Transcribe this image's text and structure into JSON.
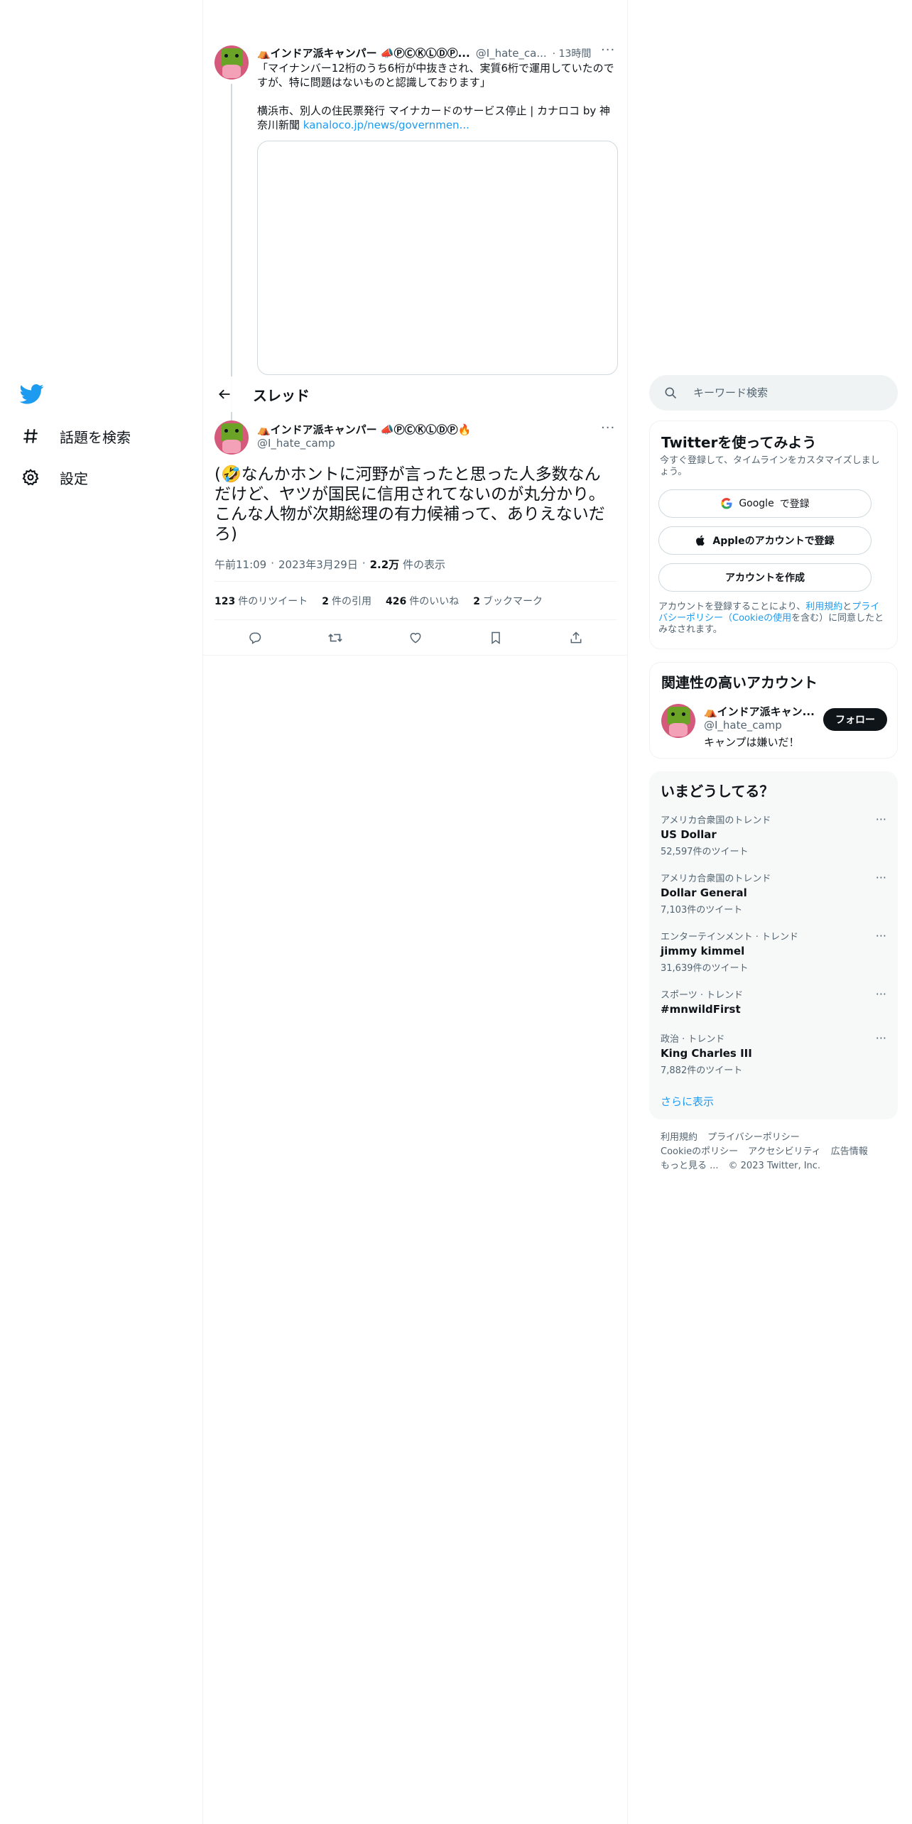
{
  "nav": {
    "items": [
      {
        "label": "話題を検索"
      },
      {
        "label": "設定"
      }
    ]
  },
  "previous_tweet": {
    "name": "⛺インドア派キャンパー 📣ⓅⒸⓀⓁⒹⓅ...",
    "handle": "@I_hate_ca...",
    "time": "· 13時間",
    "text_line1": "「マイナンバー12桁のうち6桁が中抜きされ、実質6桁で運用していたのですが、特に問題はないものと認識しております」",
    "text_line2": "横浜市、別人の住民票発行 マイナカードのサービス停止 | カナロコ by 神奈川新聞",
    "link": "kanaloco.jp/news/governmen..."
  },
  "header": {
    "title": "スレッド"
  },
  "main_tweet": {
    "name": "⛺インドア派キャンパー 📣ⓅⒸⓀⓁⒹⓅ🔥",
    "handle": "@I_hate_camp",
    "text": "(🤣なんかホントに河野が言ったと思った人多数なんだけど、ヤツが国民に信用されてないのが丸分かり。こんな人物が次期総理の有力候補って、ありえないだろ)",
    "time": "午前11:09",
    "date": "2023年3月29日",
    "views_num": "2.2万",
    "views_label": "件の表示",
    "stats": [
      {
        "num": "123",
        "label": "件のリツイート"
      },
      {
        "num": "2",
        "label": "件の引用"
      },
      {
        "num": "426",
        "label": "件のいいね"
      },
      {
        "num": "2",
        "label": "ブックマーク"
      }
    ]
  },
  "search": {
    "placeholder": "キーワード検索"
  },
  "signup": {
    "title": "Twitterを使ってみよう",
    "subtitle": "今すぐ登録して、タイムラインをカスタマイズしましょう。",
    "google_label": "で登録",
    "google_word": "Google",
    "apple_label": "Appleのアカウントで登録",
    "create_label": "アカウントを作成",
    "terms_prefix": "アカウントを登録することにより、",
    "terms_link1": "利用規約",
    "terms_and": "と",
    "terms_link2": "プライバシーポリシー（Cookieの使用",
    "terms_suffix": "を含む）に同意したとみなされます。"
  },
  "who_to_follow": {
    "title": "関連性の高いアカウント",
    "name": "⛺インドア派キャン...",
    "handle": "@I_hate_camp",
    "bio": "キャンプは嫌いだ！",
    "follow_label": "フォロー"
  },
  "trends": {
    "title": "いまどうしてる？",
    "items": [
      {
        "context": "アメリカ合衆国のトレンド",
        "name": "US Dollar",
        "count": "52,597件のツイート"
      },
      {
        "context": "アメリカ合衆国のトレンド",
        "name": "Dollar General",
        "count": "7,103件のツイート"
      },
      {
        "context": "エンターテインメント · トレンド",
        "name": "jimmy kimmel",
        "count": "31,639件のツイート"
      },
      {
        "context": "スポーツ · トレンド",
        "name": "#mnwildFirst",
        "count": ""
      },
      {
        "context": "政治 · トレンド",
        "name": "King Charles III",
        "count": "7,882件のツイート"
      }
    ],
    "show_more": "さらに表示"
  },
  "footer": {
    "links": [
      "利用規約",
      "プライバシーポリシー",
      "Cookieのポリシー",
      "アクセシビリティ",
      "広告情報",
      "もっと見る ..."
    ],
    "copyright": "© 2023 Twitter, Inc."
  }
}
